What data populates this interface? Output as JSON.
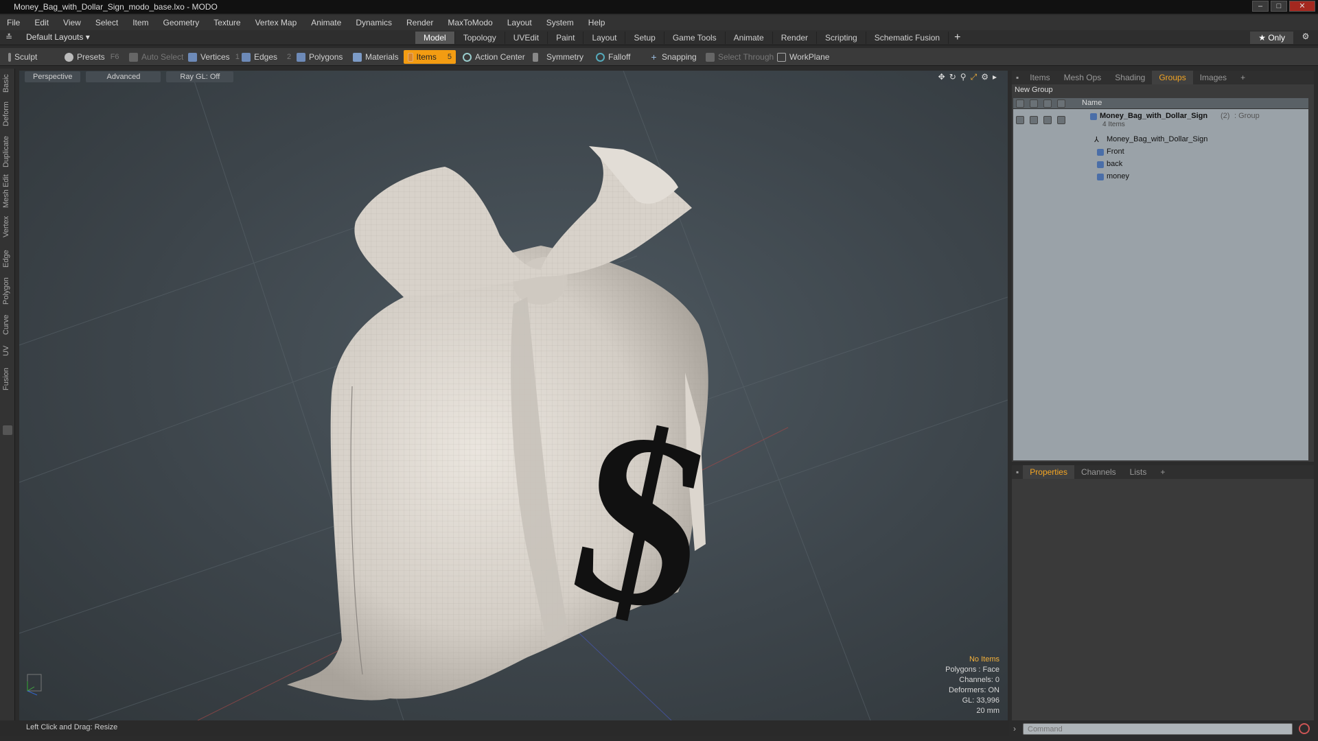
{
  "window": {
    "title": "Money_Bag_with_Dollar_Sign_modo_base.lxo - MODO"
  },
  "menu": [
    "File",
    "Edit",
    "View",
    "Select",
    "Item",
    "Geometry",
    "Texture",
    "Vertex Map",
    "Animate",
    "Dynamics",
    "Render",
    "MaxToModo",
    "Layout",
    "System",
    "Help"
  ],
  "tabbar": {
    "layout_selector": "Default Layouts ▾",
    "tabs": [
      "Model",
      "Topology",
      "UVEdit",
      "Paint",
      "Layout",
      "Setup",
      "Game Tools",
      "Animate",
      "Render",
      "Scripting",
      "Schematic Fusion"
    ],
    "active_tab": "Model",
    "only_label": "★  Only"
  },
  "toolbar": {
    "sculpt": "Sculpt",
    "presets": "Presets",
    "presets_key": "F6",
    "auto_select": "Auto Select",
    "vertices": "Vertices",
    "vertices_key": "1",
    "edges": "Edges",
    "edges_key": "2",
    "polygons": "Polygons",
    "materials": "Materials",
    "items": "Items",
    "items_key": "5",
    "action_center": "Action Center",
    "symmetry": "Symmetry",
    "falloff": "Falloff",
    "snapping": "Snapping",
    "select_through": "Select Through",
    "workplane": "WorkPlane"
  },
  "left_tabs": [
    "Basic",
    "Deform",
    "Duplicate",
    "Mesh Edit",
    "Vertex",
    "Edge",
    "Polygon",
    "Curve",
    "UV",
    "Fusion"
  ],
  "viewport": {
    "view_mode": "Perspective",
    "advanced": "Advanced",
    "raygl": "Ray GL: Off",
    "info": {
      "selection": "No Items",
      "polygons": "Polygons : Face",
      "channels": "Channels: 0",
      "deformers": "Deformers: ON",
      "gl": "GL: 33,996",
      "grid": "20 mm"
    }
  },
  "right_panel": {
    "tabs": [
      "Items",
      "Mesh Ops",
      "Shading",
      "Groups",
      "Images"
    ],
    "active_tab": "Groups",
    "new_group": "New Group",
    "column_name": "Name",
    "group": {
      "name": "Money_Bag_with_Dollar_Sign",
      "count": "(2)",
      "type": ": Group",
      "sub": "4 Items"
    },
    "items": [
      "Money_Bag_with_Dollar_Sign",
      "Front",
      "back",
      "money"
    ]
  },
  "properties_panel": {
    "tabs": [
      "Properties",
      "Channels",
      "Lists"
    ],
    "active_tab": "Properties"
  },
  "statusbar": {
    "hint": "Left Click and Drag:   Resize"
  },
  "command": {
    "placeholder": "Command"
  },
  "colors": {
    "accent": "#f39c12",
    "active_tab_text": "#f5a623"
  }
}
